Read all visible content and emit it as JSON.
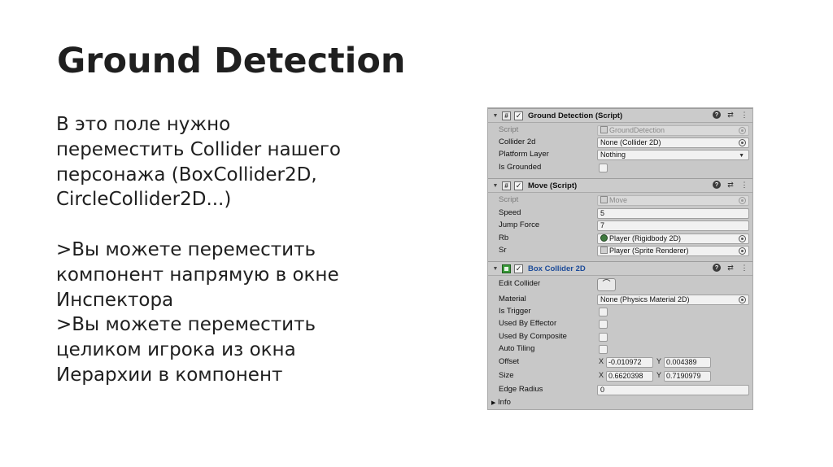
{
  "slide": {
    "title": "Ground Detection",
    "paragraphs": [
      "В это поле нужно",
      "переместить Collider нашего",
      "персонажа (BoxCollider2D,",
      "CircleCollider2D...)",
      "",
      ">Вы можете переместить",
      "компонент напрямую в окне",
      "Инспектора",
      ">Вы можете переместить",
      "целиком игрока из окна",
      "Иерархии в компонент"
    ]
  },
  "inspector": {
    "icons": {
      "fold": "triangle-down-icon",
      "script": "script-hash-icon",
      "check": "checkmark-icon",
      "help": "help-icon",
      "settings": "settings-sliders-icon",
      "more": "kebab-menu-icon",
      "picker": "object-picker-icon",
      "dropdown": "dropdown-arrow-icon"
    },
    "ground_detection": {
      "header": "Ground Detection (Script)",
      "script_label": "Script",
      "script_value": "GroundDetection",
      "collider_label": "Collider 2d",
      "collider_value": "None (Collider 2D)",
      "layer_label": "Platform Layer",
      "layer_value": "Nothing",
      "grounded_label": "Is Grounded"
    },
    "move": {
      "header": "Move (Script)",
      "script_label": "Script",
      "script_value": "Move",
      "speed_label": "Speed",
      "speed_value": "5",
      "jump_label": "Jump Force",
      "jump_value": "7",
      "rb_label": "Rb",
      "rb_value": "Player (Rigidbody 2D)",
      "sr_label": "Sr",
      "sr_value": "Player (Sprite Renderer)"
    },
    "box_collider": {
      "header": "Box Collider 2D",
      "edit_label": "Edit Collider",
      "material_label": "Material",
      "material_value": "None (Physics Material 2D)",
      "trigger_label": "Is Trigger",
      "effector_label": "Used By Effector",
      "composite_label": "Used By Composite",
      "tiling_label": "Auto Tiling",
      "offset_label": "Offset",
      "offset_x": "-0.010972",
      "offset_y": "0.004389",
      "size_label": "Size",
      "size_x": "0.6620398",
      "size_y": "0.7190979",
      "x_axis": "X",
      "y_axis": "Y",
      "edge_label": "Edge Radius",
      "edge_value": "0",
      "info_label": "Info"
    }
  }
}
